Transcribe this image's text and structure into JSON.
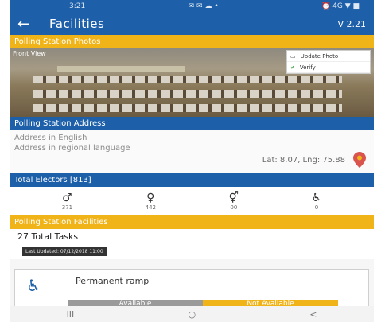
{
  "status_bar": {
    "time": "3:21",
    "icons_left": "✉ ✉ ☁ •",
    "icons_right": "⏰ 4G ▼ ■"
  },
  "app_bar": {
    "title": "Facilities",
    "version": "V 2.21"
  },
  "photos_section": {
    "title": "Polling Station Photos",
    "view_label": "Front View",
    "menu": {
      "update": "Update Photo",
      "verify": "Verify"
    }
  },
  "address_section": {
    "title": "Polling Station Address",
    "english": "Address in English",
    "regional": "Address in regional language",
    "latlng": "Lat: 8.07, Lng: 75.88"
  },
  "electors": {
    "title": "Total Electors [813]",
    "items": [
      {
        "icon": "male-icon",
        "glyph": "♂",
        "count": "371"
      },
      {
        "icon": "female-icon",
        "glyph": "♀",
        "count": "442"
      },
      {
        "icon": "transgender-icon",
        "glyph": "⚥",
        "count": "00"
      },
      {
        "icon": "wheelchair-icon",
        "glyph": "♿",
        "count": "0"
      }
    ]
  },
  "facilities_section": {
    "title": "Polling Station Facilities"
  },
  "tasks": {
    "label": "27 Total Tasks"
  },
  "stamp": {
    "text": "Last Updated: 07/12/2018 11:00"
  },
  "facility_card": {
    "name": "Permanent ramp",
    "available": "Available",
    "not_available": "Not Available"
  },
  "nav": {
    "recent": "III",
    "home": "○",
    "back": "<"
  },
  "colors": {
    "primary": "#1d5fa8",
    "accent": "#f0b318"
  }
}
